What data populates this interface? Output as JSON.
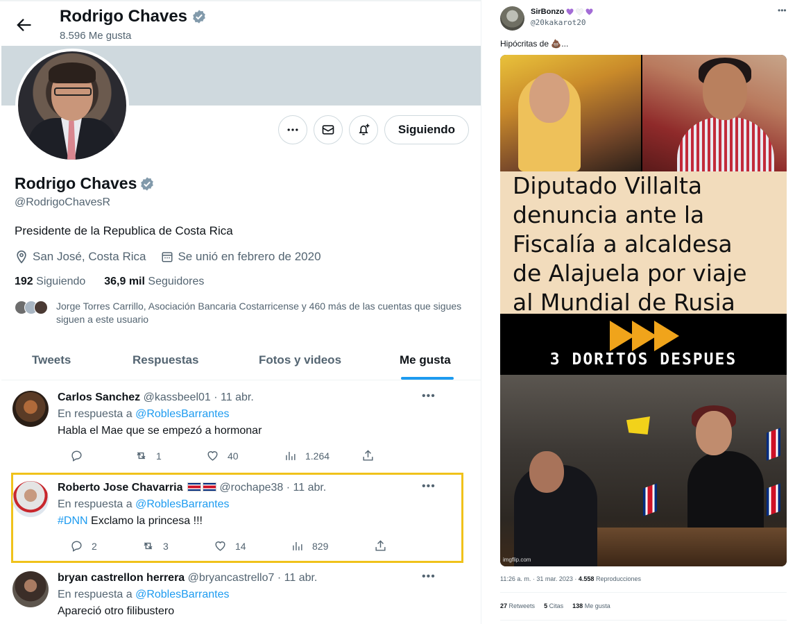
{
  "profile_header": {
    "name": "Rodrigo Chaves",
    "likes_count": "8.596 Me gusta"
  },
  "profile": {
    "name": "Rodrigo Chaves",
    "handle": "@RodrigoChavesR",
    "bio": "Presidente de la Republica de Costa Rica",
    "location": "San José, Costa Rica",
    "joined": "Se unió en febrero de 2020",
    "following_count": "192",
    "following_label": "Siguiendo",
    "followers_count": "36,9 mil",
    "followers_label": "Seguidores",
    "followed_by": "Jorge Torres Carrillo, Asociación Bancaria Costarricense y 460 más de las cuentas que sigues siguen a este usuario",
    "follow_button": "Siguiendo",
    "more_icon": "more-icon",
    "message_icon": "mail-icon",
    "notify_icon": "bell-plus-icon"
  },
  "tabs": [
    {
      "label": "Tweets"
    },
    {
      "label": "Respuestas"
    },
    {
      "label": "Fotos y videos"
    },
    {
      "label": "Me gusta",
      "active": true
    }
  ],
  "tweets": [
    {
      "author": "Carlos Sanchez",
      "handle": "@kassbeel01",
      "date": "· 11 abr.",
      "reply_prefix": "En respuesta a",
      "reply_to": "@RoblesBarrantes",
      "text": "Habla el Mae que se empezó a hormonar",
      "replies": "",
      "retweets": "1",
      "likes": "40",
      "views": "1.264"
    },
    {
      "author": "Roberto Jose Chavarria",
      "handle": "@rochape38",
      "date": "· 11 abr.",
      "reply_prefix": "En respuesta a",
      "reply_to": "@RoblesBarrantes",
      "hashtag": "#DNN",
      "text": "Exclamo la princesa !!!",
      "replies": "2",
      "retweets": "3",
      "likes": "14",
      "views": "829"
    },
    {
      "author": "bryan castrellon herrera",
      "handle": "@bryancastrello7",
      "date": "· 11 abr.",
      "reply_prefix": "En respuesta a",
      "reply_to": "@RoblesBarrantes",
      "text": "Apareció otro filibustero"
    }
  ],
  "right_tweet": {
    "author": "SirBonzo",
    "handle": "@20kakarot20",
    "text": "Hipócritas de 💩...",
    "meme_lines": [
      "Diputado Villalta",
      "denuncia ante la",
      "Fiscalía a alcaldesa",
      "de Alajuela por viaje",
      "al Mundial de Rusia"
    ],
    "meme_caption": "3 DORITOS DESPUES",
    "watermark": "imgflip.com",
    "timestamp": "11:26 a. m. · 31 mar. 2023 ·",
    "views": "4.558",
    "views_label": "Reproducciones",
    "retweets": "27",
    "retweets_label": "Retweets",
    "quotes": "5",
    "quotes_label": "Citas",
    "likes": "138",
    "likes_label": "Me gusta"
  },
  "colors": {
    "accent": "#1d9bf0",
    "highlight_border": "#f0c21b",
    "secondary_text": "#536471",
    "verified": "#829aab",
    "heart_purple": "#a36cd6"
  }
}
